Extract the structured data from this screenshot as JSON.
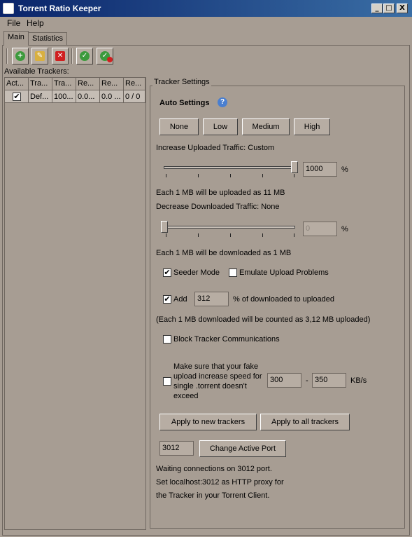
{
  "window": {
    "title": "Torrent Ratio Keeper",
    "controls": {
      "minimize": "_",
      "maximize": "□",
      "close": "X"
    }
  },
  "menu": [
    "File",
    "Help"
  ],
  "tabs": [
    "Main",
    "Statistics"
  ],
  "toolbar": {
    "icons": [
      "add-icon",
      "settings-icon",
      "delete-icon",
      "enable-icon",
      "disable-icon"
    ]
  },
  "trackers": {
    "label": "Available Trackers:",
    "columns": [
      "Act...",
      "Tra...",
      "Tra...",
      "Re...",
      "Re...",
      "Re..."
    ],
    "rows": [
      {
        "active": "✔",
        "c1": "Def...",
        "c2": "100...",
        "c3": "0.0...",
        "c4": "0.0 ...",
        "c5": "0 / 0"
      }
    ]
  },
  "settings": {
    "legend": "Tracker Settings",
    "auto_title": "Auto Settings",
    "presets": [
      "None",
      "Low",
      "Medium",
      "High"
    ],
    "upload_label": "Increase Uploaded Traffic: Custom",
    "upload_value": "1000",
    "upload_level": 1.0,
    "percent": "%",
    "upload_note": "Each 1 MB will be uploaded as 11 MB",
    "download_label": "Decrease Downloaded Traffic: None",
    "download_value": "0",
    "download_level": 0.0,
    "download_note": "Each 1 MB will be downloaded as 1 MB",
    "seeder_mode": "Seeder Mode",
    "emulate_problems": "Emulate Upload Problems",
    "add_label": "Add",
    "add_value": "312",
    "add_suffix": "% of downloaded to uploaded",
    "add_note": "(Each 1 MB downloaded will be counted as 3,12 MB uploaded)",
    "block_label": "Block Tracker Communications",
    "speed_label_lines": [
      "Make sure that your fake",
      "upload increase speed for",
      "single .torrent doesn't",
      "exceed"
    ],
    "speed_min": "300",
    "speed_dash": "-",
    "speed_max": "350",
    "speed_unit": "KB/s",
    "apply_new": "Apply to new trackers",
    "apply_all": "Apply to all trackers",
    "port_value": "3012",
    "change_port": "Change Active Port",
    "status_lines": [
      "Waiting connections on 3012 port.",
      "Set localhost:3012 as HTTP proxy for",
      "the Tracker in your Torrent Client."
    ]
  }
}
